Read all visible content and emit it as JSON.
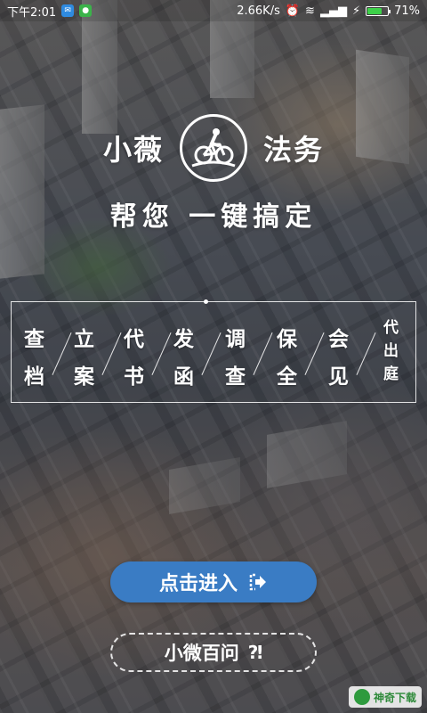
{
  "status_bar": {
    "time": "下午2:01",
    "network_speed": "2.66K/s",
    "battery_percent": "71%",
    "battery_level": 0.71
  },
  "logo": {
    "left_text": "小薇",
    "right_text": "法务",
    "emblem_icon": "cyclist-emblem-icon"
  },
  "slogan": "帮您 一键搞定",
  "services": [
    {
      "line1": "查",
      "line2": "档"
    },
    {
      "line1": "立",
      "line2": "案"
    },
    {
      "line1": "代",
      "line2": "书"
    },
    {
      "line1": "发",
      "line2": "函"
    },
    {
      "line1": "调",
      "line2": "查"
    },
    {
      "line1": "保",
      "line2": "全"
    },
    {
      "line1": "会",
      "line2": "见"
    },
    {
      "line1": "代",
      "line2": "出",
      "line3": "庭"
    }
  ],
  "buttons": {
    "enter_label": "点击进入",
    "qa_label": "小微百问"
  },
  "watermark": {
    "text": "神奇下载"
  },
  "colors": {
    "enter_button": "#3a7cc4",
    "battery_fill": "#3ed14a"
  }
}
